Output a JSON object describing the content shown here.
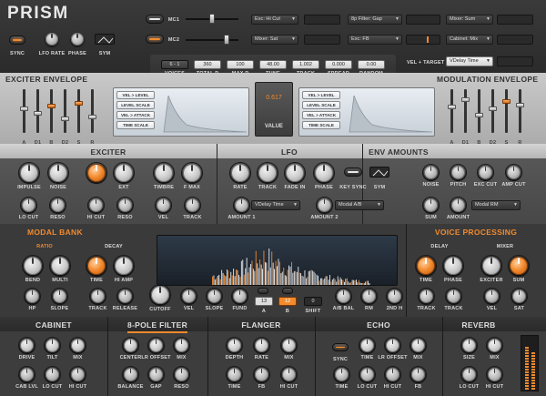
{
  "app": {
    "title": "PRISM"
  },
  "colors": {
    "accent": "#f28a2e",
    "panel_dark": "#2b2b2b",
    "panel_light": "#bdbdbd",
    "display": "#cfd6de"
  },
  "top": {
    "sync": "SYNC",
    "lfo_rate": "LFO RATE",
    "phase": "PHASE",
    "sym": "SYM",
    "mc1": "MC1",
    "mc2": "MC2",
    "mc1_targets": [
      "Exc: Hi Cut",
      "8p Filter: Gap",
      "Mixer: Sum"
    ],
    "mc2_targets": [
      "Mixer: Sat",
      "Exc: FB",
      "Cabinet: Mix"
    ]
  },
  "info": {
    "labels": [
      "VOICES",
      "TOTAL P",
      "MAX P",
      "TUNE",
      "TRACK",
      "SPREAD",
      "RANDOM"
    ],
    "values": [
      "6 - 1",
      "360",
      "100",
      "48.00",
      "1.002",
      "0.000",
      "0.00"
    ],
    "vel_target_label": "VEL + TARGET",
    "vel_target_value": "VDelay Time"
  },
  "exciter_env": {
    "title": "EXCITER ENVELOPE",
    "labels": [
      "A",
      "D1",
      "B",
      "D2",
      "S",
      "R"
    ],
    "levels": [
      0.55,
      0.45,
      0.62,
      0.3,
      0.7,
      0.35
    ],
    "buttons": [
      "VEL > LEVEL",
      "LEVEL SCALE",
      "VEL > ATTACK",
      "TIME SCALE"
    ]
  },
  "value_display": {
    "number": "0.617",
    "label": "VALUE"
  },
  "mod_env": {
    "title": "MODULATION ENVELOPE",
    "labels": [
      "A",
      "D1",
      "B",
      "D2",
      "S",
      "R"
    ],
    "levels": [
      0.6,
      0.8,
      0.4,
      0.55,
      0.75,
      0.65
    ],
    "buttons": [
      "VEL > LEVEL",
      "LEVEL SCALE",
      "VEL > ATTACK",
      "TIME SCALE"
    ]
  },
  "exciter": {
    "title": "EXCITER",
    "row1": [
      "IMPULSE",
      "NOISE",
      "",
      "EXT",
      "",
      "TIMBRE",
      "F MAX"
    ],
    "row2": [
      "LO CUT",
      "RESO",
      "HI CUT",
      "RESO",
      "VEL",
      "TRACK"
    ]
  },
  "lfo": {
    "title": "LFO",
    "row1": [
      "RATE",
      "TRACK",
      "FADE IN",
      "PHASE",
      "KEY SYNC",
      "SYM"
    ],
    "amount1": "AMOUNT 1",
    "amount2": "AMOUNT 2",
    "target1": "VDelay Time",
    "target2": "Modal A/B"
  },
  "env_amounts": {
    "title": "ENV AMOUNTS",
    "row1": [
      "NOISE",
      "PITCH",
      "EXC CUT",
      "AMP CUT"
    ],
    "row2": [
      "SUM",
      "AMOUNT"
    ],
    "target": "Modal RM"
  },
  "modal_bank": {
    "title": "MODAL BANK",
    "ratio": "RATIO",
    "decay": "DECAY",
    "row1": [
      "BEND",
      "MULTI",
      "TIME",
      "HI AMP"
    ],
    "row2": [
      "HP",
      "SLOPE",
      "TRACK",
      "RELEASE",
      "CUTOFF",
      "VEL",
      "SLOPE",
      "FUND"
    ],
    "ab": [
      "A",
      "B"
    ],
    "ab_values": [
      "13",
      "12",
      "0"
    ],
    "shift": "SHIFT",
    "ab_bal": "A/B BAL",
    "rm": "RM",
    "2nd_h": "2ND H"
  },
  "voice_processing": {
    "title": "VOICE PROCESSING",
    "delay": "DELAY",
    "mixer": "MIXER",
    "row1": [
      "TIME",
      "PHASE",
      "EXCITER",
      "SUM"
    ],
    "row2": [
      "TRACK",
      "TRACK",
      "VEL",
      "SAT"
    ]
  },
  "bottom": {
    "cabinet": {
      "title": "CABINET",
      "row1": [
        "DRIVE",
        "TILT",
        "MIX"
      ],
      "row2": [
        "CAB LVL",
        "LO CUT",
        "HI CUT"
      ]
    },
    "filter": {
      "title": "8-POLE FILTER",
      "row1": [
        "CENTER",
        "LR OFFSET",
        "MIX"
      ],
      "row2": [
        "BALANCE",
        "GAP",
        "RESO"
      ]
    },
    "flanger": {
      "title": "FLANGER",
      "row1": [
        "DEPTH",
        "RATE",
        "MIX"
      ],
      "row2": [
        "TIME",
        "FB",
        "HI CUT"
      ]
    },
    "echo": {
      "title": "ECHO",
      "row1": [
        "SYNC",
        "TIME",
        "LR OFFSET",
        "MIX"
      ],
      "row2": [
        "TIME",
        "LO CUT",
        "HI CUT",
        "FB"
      ]
    },
    "reverb": {
      "title": "REVERB",
      "row1": [
        "SIZE",
        "MIX"
      ],
      "row2": [
        "LO CUT",
        "HI CUT"
      ]
    }
  }
}
